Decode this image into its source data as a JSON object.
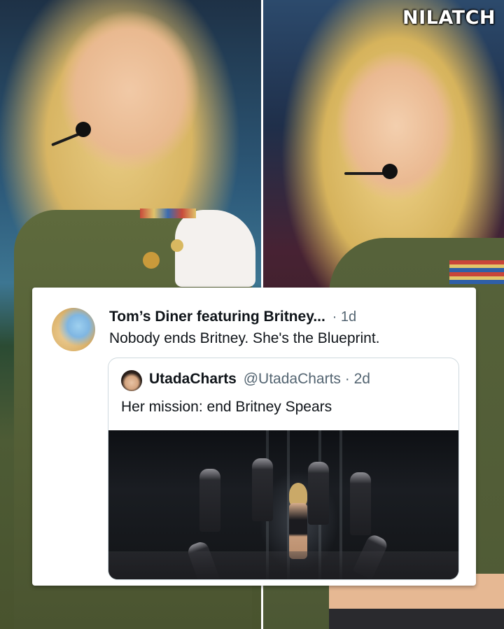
{
  "watermark": "NILATCH",
  "post": {
    "author_name": "Tom’s Diner featuring Britney...",
    "time": "· 1d",
    "text": "Nobody ends Britney. She's the Blueprint."
  },
  "quoted_post": {
    "author_name": "UtadaCharts",
    "handle": "@UtadaCharts",
    "time": "· 2d",
    "text": "Her mission: end Britney Spears"
  },
  "colors": {
    "card_background": "#ffffff",
    "primary_text": "#0f1419",
    "secondary_text": "#536471",
    "quote_border": "#cfd9de"
  }
}
